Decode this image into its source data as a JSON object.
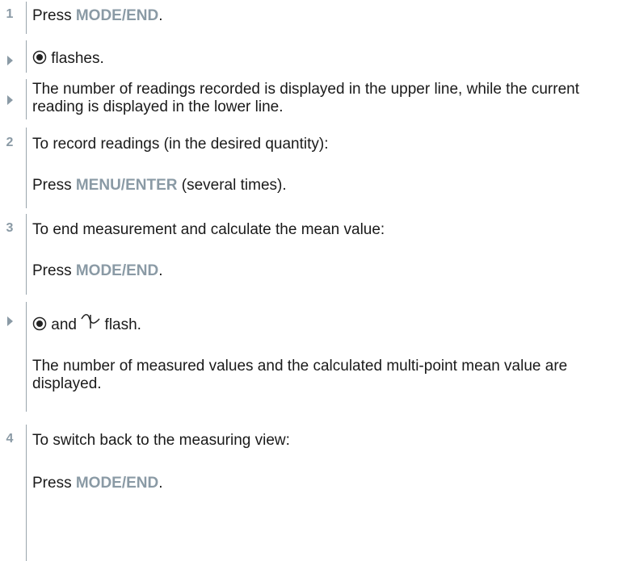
{
  "steps": [
    {
      "marker": "1",
      "pre": "Press ",
      "key": "MODE/END",
      "post": "."
    },
    {
      "icon": "record-indicator-icon",
      "text": " flashes."
    },
    {
      "text": "The number of readings recorded is displayed in the upper line, while the current reading is displayed in the lower line."
    },
    {
      "marker": "2",
      "text": "To record readings (in the desired quantity):",
      "sub_pre": "Press ",
      "sub_key": "MENU/ENTER",
      "sub_post": " (several times)."
    },
    {
      "marker": "3",
      "text": "To end measurement and calculate the mean value:",
      "sub_pre": "Press ",
      "sub_key": "MODE/END",
      "sub_post": "."
    },
    {
      "icons": [
        "record-indicator-icon",
        "mean-value-icon"
      ],
      "mid": " and ",
      "post": " flash.",
      "sub_text": "The number of measured values and the calculated multi-point mean value are displayed."
    },
    {
      "marker": "4",
      "text": "To switch back to the measuring view:",
      "sub_pre": "Press ",
      "sub_key": "MODE/END",
      "sub_post": "."
    }
  ],
  "colors": {
    "accent": "#8a9aa5",
    "text": "#1a1a1a"
  }
}
